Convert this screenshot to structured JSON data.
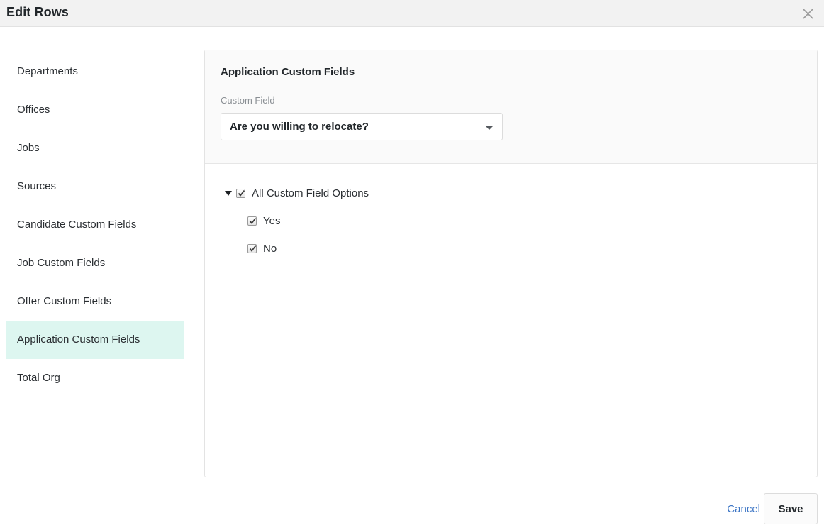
{
  "window": {
    "title": "Edit Rows",
    "close_icon": "close-icon"
  },
  "sidebar": {
    "items": [
      {
        "label": "Departments",
        "selected": false
      },
      {
        "label": "Offices",
        "selected": false
      },
      {
        "label": "Jobs",
        "selected": false
      },
      {
        "label": "Sources",
        "selected": false
      },
      {
        "label": "Candidate Custom Fields",
        "selected": false
      },
      {
        "label": "Job Custom Fields",
        "selected": false
      },
      {
        "label": "Offer Custom Fields",
        "selected": false
      },
      {
        "label": "Application Custom Fields",
        "selected": true
      },
      {
        "label": "Total Org",
        "selected": false
      }
    ],
    "selected_background": "#ddf6f0"
  },
  "panel": {
    "title": "Application Custom Fields",
    "field_label": "Custom Field",
    "select": {
      "value": "Are you willing to relocate?",
      "arrow_icon": "chevron-down-icon"
    },
    "tree": {
      "twisty_icon": "triangle-down-icon",
      "root": {
        "label": "All Custom Field Options",
        "checked": true
      },
      "children": [
        {
          "label": "Yes",
          "checked": true
        },
        {
          "label": "No",
          "checked": true
        }
      ]
    }
  },
  "footer": {
    "cancel_label": "Cancel",
    "save_label": "Save",
    "cancel_color": "#3973c4"
  }
}
